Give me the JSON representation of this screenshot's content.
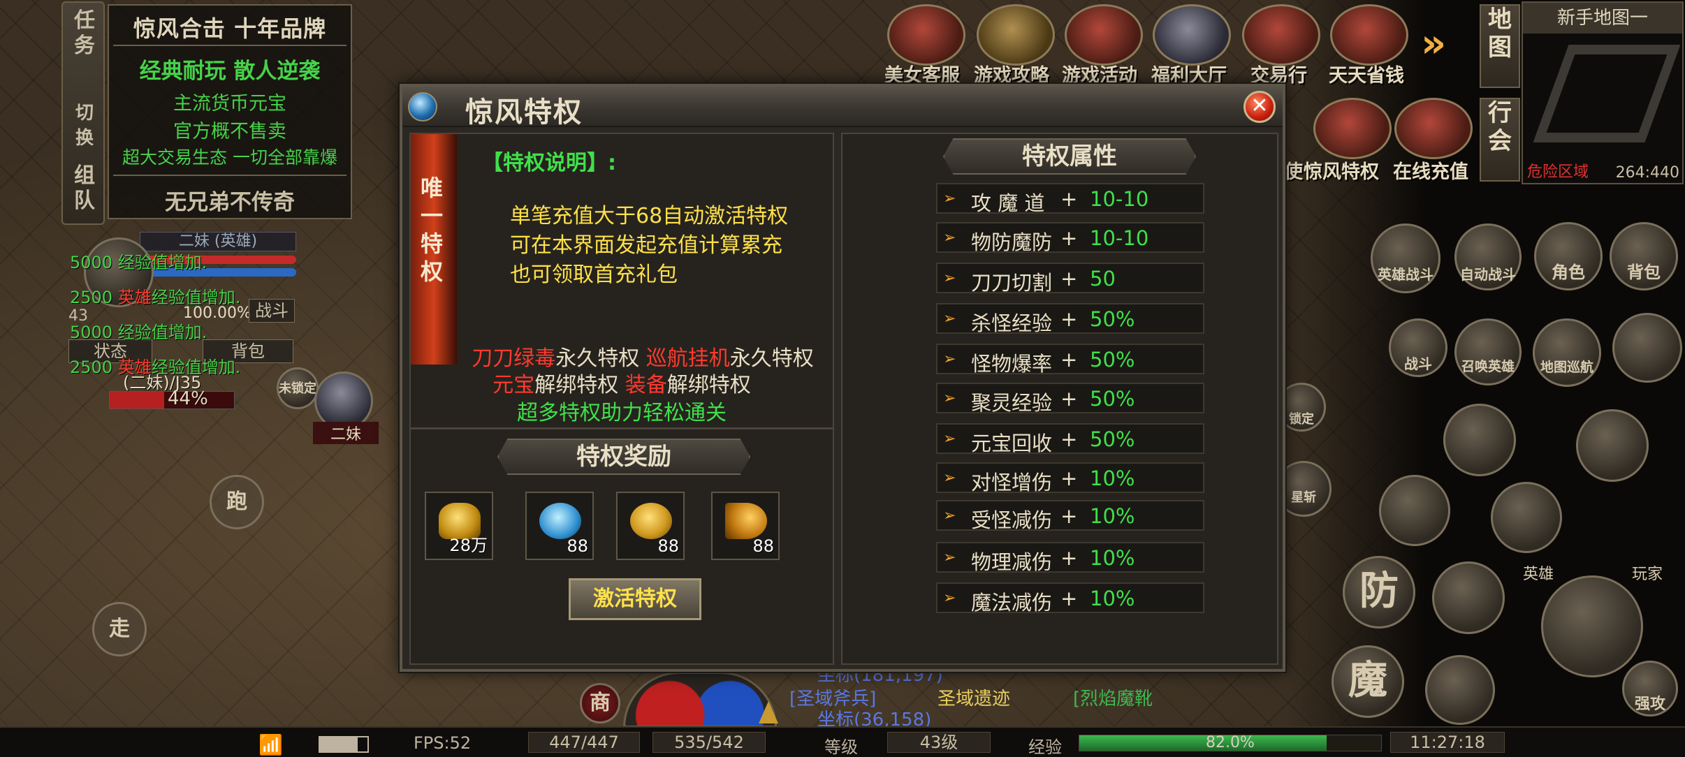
{
  "left_tabs": [
    "任务",
    "切换",
    "组队"
  ],
  "notice": {
    "title": "惊风合击 十年品牌",
    "line1": "经典耐玩 散人逆袭",
    "line2": "主流货币元宝",
    "line3": "官方概不售卖",
    "line4": "超大交易生态 一切全部靠爆",
    "footer": "无兄弟不传奇"
  },
  "hero": {
    "name": "二妹 (英雄)",
    "loyalty": "100.00%",
    "level_num": "43",
    "battle_label": "战斗",
    "status_label": "状态",
    "bag_label": "背包",
    "level_text": "(二妹)/J35",
    "hp_pct": "44%",
    "portrait_label": "二妹",
    "lock_label": "未锁定"
  },
  "exp_messages": [
    {
      "amount": "5000",
      "prefix": "",
      "text": "经验值增加."
    },
    {
      "amount": "2500",
      "prefix": "英雄",
      "text": "经验值增加."
    },
    {
      "amount": "5000",
      "prefix": "",
      "text": "经验值增加."
    },
    {
      "amount": "2500",
      "prefix": "英雄",
      "text": "经验值增加."
    }
  ],
  "run_label": "跑",
  "walk_label": "走",
  "top_icons": [
    "美女客服",
    "游戏攻略",
    "游戏活动",
    "福利大厅",
    "交易行",
    "天天省钱"
  ],
  "second_icons": [
    "使",
    "惊风特权",
    "在线充值"
  ],
  "right_vert": [
    "地图",
    "行会"
  ],
  "minimap": {
    "title": "新手地图一",
    "danger": "危险区域",
    "coords": "264:440"
  },
  "right_buttons": {
    "hero_battle": "英雄战斗",
    "auto_battle": "自动战斗",
    "role": "角色",
    "bag": "背包",
    "fight": "战斗",
    "summon": "召唤英雄",
    "patrol": "地图巡航",
    "lock": "锁定",
    "star": "星斩",
    "defend": "防",
    "magic": "魔",
    "strong": "强攻",
    "hero_tag": "英雄",
    "player_tag": "玩家"
  },
  "dialog": {
    "title": "惊风特权",
    "close": "✕",
    "unique_ribbon": [
      "唯",
      "一",
      "特",
      "权"
    ],
    "desc_title": "【特权说明】:",
    "desc_lines": [
      "单笔充值大于68自动激活特权",
      "可在本界面发起充值计算累充",
      "也可领取首充礼包"
    ],
    "features": {
      "l1_a": "刀刀绿毒",
      "l1_b": "永久特权",
      "l1_c": "巡航挂机",
      "l1_d": "永久特权",
      "l2_a": "元宝",
      "l2_b": "解绑特权",
      "l2_c": "装备",
      "l2_d": "解绑特权",
      "l3": "超多特权助力轻松通关"
    },
    "reward_title": "特权奖励",
    "rewards": [
      {
        "icon": "gold-ingot-icon",
        "count": "28万"
      },
      {
        "icon": "blue-gem-icon",
        "count": "88"
      },
      {
        "icon": "gold-coin-icon",
        "count": "88"
      },
      {
        "icon": "horn-icon",
        "count": "88"
      }
    ],
    "activate_label": "激活特权",
    "attr_title": "特权属性",
    "attributes": [
      {
        "name": "攻 魔 道",
        "plus": "+",
        "value": "10-10"
      },
      {
        "name": "物防魔防",
        "plus": "+",
        "value": "10-10"
      },
      {
        "name": "刀刀切割",
        "plus": "+",
        "value": "50"
      },
      {
        "name": "杀怪经验",
        "plus": "+",
        "value": "50%"
      },
      {
        "name": "怪物爆率",
        "plus": "+",
        "value": "50%"
      },
      {
        "name": "聚灵经验",
        "plus": "+",
        "value": "50%"
      },
      {
        "name": "元宝回收",
        "plus": "+",
        "value": "50%"
      },
      {
        "name": "对怪增伤",
        "plus": "+",
        "value": "10%"
      },
      {
        "name": "受怪减伤",
        "plus": "+",
        "value": "10%"
      },
      {
        "name": "物理减伤",
        "plus": "+",
        "value": "10%"
      },
      {
        "name": "魔法减伤",
        "plus": "+",
        "value": "10%"
      }
    ]
  },
  "chat": {
    "line1": "坐标(181,197)",
    "line2_a": "[圣域斧兵]",
    "line2_b": "圣域遗迹",
    "line2_c": "[烈焰魔靴",
    "line3": "坐标(36,158)"
  },
  "shop_label": "商",
  "bottom": {
    "fps": "FPS:52",
    "hp": "447/447",
    "mp": "535/542",
    "level_label": "等级",
    "level": "43级",
    "exp_label": "经验",
    "exp_pct": "82.0%",
    "exp_fraction": 0.82,
    "time": "11:27:18"
  }
}
